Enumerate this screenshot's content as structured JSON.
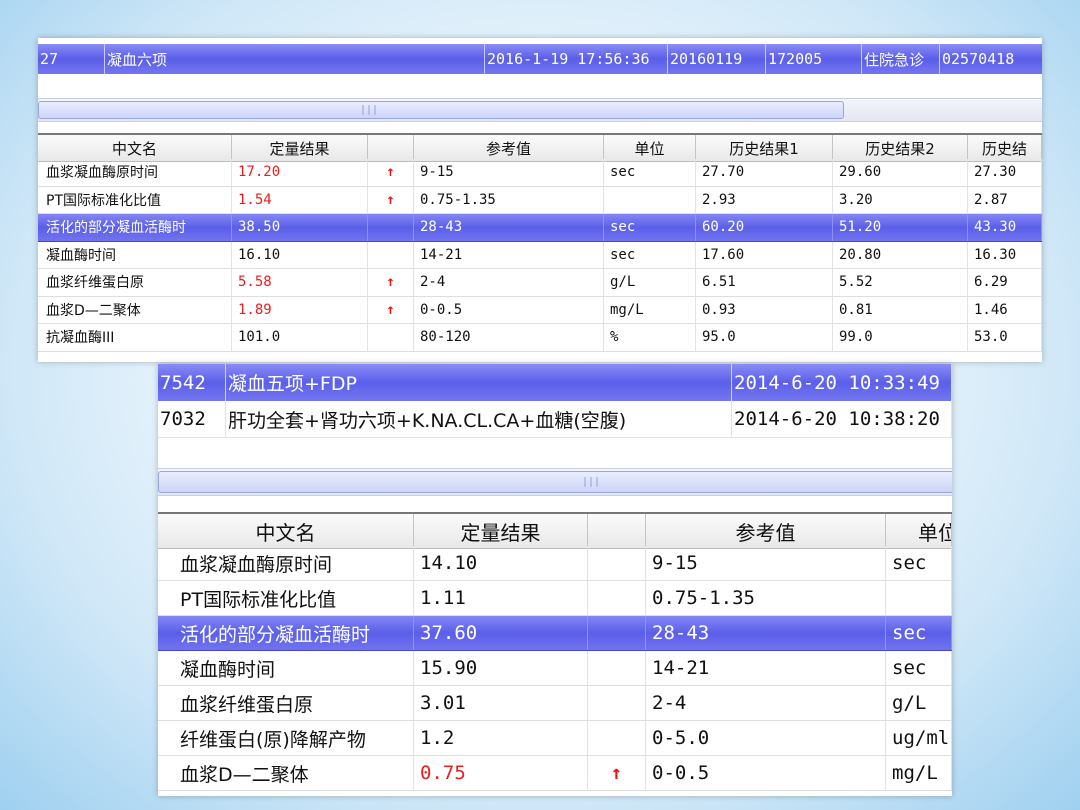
{
  "screenshot1": {
    "header": [
      "27",
      "凝血六项",
      "2016-1-19 17:56:36",
      "20160119",
      "172005",
      "住院急诊",
      "02570418"
    ],
    "columns": [
      "中文名",
      "定量结果",
      "",
      "参考值",
      "单位",
      "历史结果1",
      "历史结果2",
      "历史结"
    ],
    "rows": [
      {
        "name": "血浆凝血酶原时间",
        "result": "17.20",
        "flag": "↑",
        "ref": "9-15",
        "unit": "sec",
        "h1": "27.70",
        "h2": "29.60",
        "h3": "27.30",
        "high": true
      },
      {
        "name": "PT国际标准化比值",
        "result": "1.54",
        "flag": "↑",
        "ref": "0.75-1.35",
        "unit": "",
        "h1": "2.93",
        "h2": "3.20",
        "h3": "2.87",
        "high": true
      },
      {
        "name": "活化的部分凝血活酶时",
        "result": "38.50",
        "flag": "",
        "ref": "28-43",
        "unit": "sec",
        "h1": "60.20",
        "h2": "51.20",
        "h3": "43.30",
        "selected": true
      },
      {
        "name": "凝血酶时间",
        "result": "16.10",
        "flag": "",
        "ref": "14-21",
        "unit": "sec",
        "h1": "17.60",
        "h2": "20.80",
        "h3": "16.30"
      },
      {
        "name": "血浆纤维蛋白原",
        "result": "5.58",
        "flag": "↑",
        "ref": "2-4",
        "unit": "g/L",
        "h1": "6.51",
        "h2": "5.52",
        "h3": "6.29",
        "high": true
      },
      {
        "name": "血浆D—二聚体",
        "result": "1.89",
        "flag": "↑",
        "ref": "0-0.5",
        "unit": "mg/L",
        "h1": "0.93",
        "h2": "0.81",
        "h3": "1.46",
        "high": true
      },
      {
        "name": "抗凝血酶III",
        "result": "101.0",
        "flag": "",
        "ref": "80-120",
        "unit": "%",
        "h1": "95.0",
        "h2": "99.0",
        "h3": "53.0"
      }
    ]
  },
  "screenshot2": {
    "orders": [
      {
        "id": "7542",
        "name": "凝血五项+FDP",
        "time": "2014-6-20 10:33:49",
        "selected": true
      },
      {
        "id": "7032",
        "name": "肝功全套+肾功六项+K.NA.CL.CA+血糖(空腹)",
        "time": "2014-6-20 10:38:20"
      }
    ],
    "columns": [
      "中文名",
      "定量结果",
      "",
      "参考值",
      "单位"
    ],
    "rows": [
      {
        "name": "血浆凝血酶原时间",
        "result": "14.10",
        "flag": "",
        "ref": "9-15",
        "unit": "sec"
      },
      {
        "name": "PT国际标准化比值",
        "result": "1.11",
        "flag": "",
        "ref": "0.75-1.35",
        "unit": ""
      },
      {
        "name": "活化的部分凝血活酶时",
        "result": "37.60",
        "flag": "",
        "ref": "28-43",
        "unit": "sec",
        "selected": true
      },
      {
        "name": "凝血酶时间",
        "result": "15.90",
        "flag": "",
        "ref": "14-21",
        "unit": "sec"
      },
      {
        "name": "血浆纤维蛋白原",
        "result": "3.01",
        "flag": "",
        "ref": "2-4",
        "unit": "g/L"
      },
      {
        "name": "纤维蛋白(原)降解产物",
        "result": "1.2",
        "flag": "",
        "ref": "0-5.0",
        "unit": "ug/ml"
      },
      {
        "name": "血浆D—二聚体",
        "result": "0.75",
        "flag": "↑",
        "ref": "0-0.5",
        "unit": "mg/L",
        "high": true
      }
    ]
  },
  "colors": {
    "selection": "#5b5fe9",
    "abnormal": "#ee1c1c",
    "background": "#cfe7f7"
  },
  "icons": {
    "scroll_grip": "grip-icon",
    "abnormal_flag": "up-arrow-icon"
  }
}
